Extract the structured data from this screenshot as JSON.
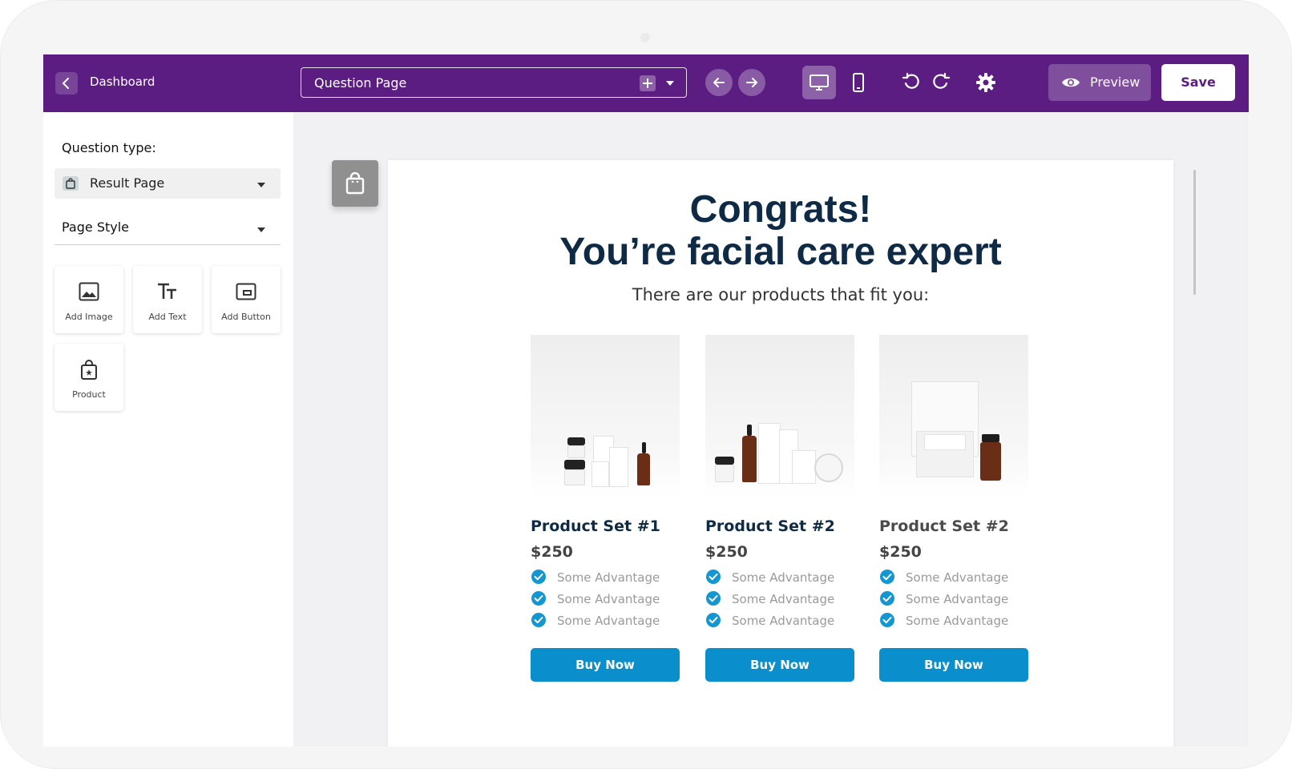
{
  "topbar": {
    "dashboard_label": "Dashboard",
    "page_selector_value": "Question Page",
    "preview_label": "Preview",
    "save_label": "Save",
    "colors": {
      "bar": "#5b1d82",
      "button_blue": "#0a8fcc"
    }
  },
  "icons": [
    "chevron-left-icon",
    "plus-icon",
    "chevron-down-icon",
    "arrow-left-icon",
    "arrow-right-icon",
    "desktop-icon",
    "mobile-icon",
    "undo-icon",
    "redo-icon",
    "gear-icon",
    "eye-icon",
    "shopping-bag-icon",
    "image-icon",
    "text-icon",
    "button-icon",
    "check-circle-icon"
  ],
  "left_panel": {
    "question_type_label": "Question type:",
    "question_type_value": "Result Page",
    "page_style_label": "Page Style",
    "tools": [
      {
        "label": "Add Image"
      },
      {
        "label": "Add Text"
      },
      {
        "label": "Add Button"
      },
      {
        "label": "Product"
      }
    ]
  },
  "result": {
    "headline_1": "Congrats!",
    "headline_2": "You’re facial care expert",
    "subtitle": "There are our products that fit you:",
    "products": [
      {
        "name": "Product Set #1",
        "price": "$250",
        "advantages": [
          "Some Advantage",
          "Some Advantage",
          "Some Advantage"
        ],
        "button": "Buy Now"
      },
      {
        "name": "Product Set #2",
        "price": "$250",
        "advantages": [
          "Some Advantage",
          "Some Advantage",
          "Some Advantage"
        ],
        "button": "Buy Now"
      },
      {
        "name": "Product Set #2",
        "price": "$250",
        "advantages": [
          "Some Advantage",
          "Some Advantage",
          "Some Advantage"
        ],
        "button": "Buy Now"
      }
    ]
  }
}
